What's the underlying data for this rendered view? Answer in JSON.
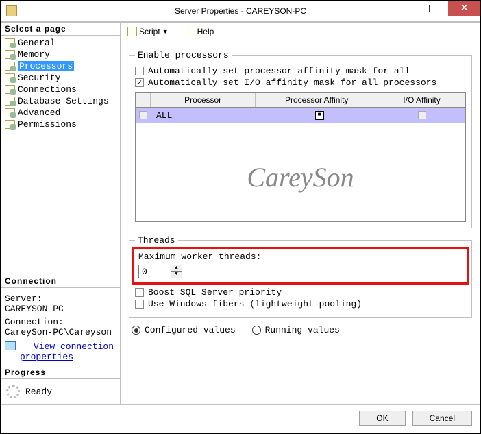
{
  "titlebar": {
    "text": "Server Properties - CAREYSON-PC"
  },
  "sidebar": {
    "select_header": "Select a page",
    "pages": [
      {
        "label": "General"
      },
      {
        "label": "Memory"
      },
      {
        "label": "Processors"
      },
      {
        "label": "Security"
      },
      {
        "label": "Connections"
      },
      {
        "label": "Database Settings"
      },
      {
        "label": "Advanced"
      },
      {
        "label": "Permissions"
      }
    ],
    "connection_header": "Connection",
    "server_label": "Server:",
    "server_value": "CAREYSON-PC",
    "conn_label": "Connection:",
    "conn_value": "CareySon-PC\\Careyson",
    "view_link1": "View connection",
    "view_link2": "properties",
    "progress_header": "Progress",
    "progress_state": "Ready"
  },
  "toolbar": {
    "script": "Script",
    "help": "Help"
  },
  "enable": {
    "legend": "Enable processors",
    "opt1": "Automatically set processor affinity mask for all",
    "opt2": "Automatically set I/O affinity mask for all processors",
    "th_proc": "Processor",
    "th_pa": "Processor Affinity",
    "th_io": "I/O Affinity",
    "row_all": "ALL"
  },
  "watermark": "CareySon",
  "threads": {
    "legend": "Threads",
    "max_label": "Maximum worker threads:",
    "max_value": "0",
    "boost": "Boost SQL Server priority",
    "fibers": "Use Windows fibers (lightweight pooling)"
  },
  "values": {
    "configured": "Configured  values",
    "running": "Running values"
  },
  "buttons": {
    "ok": "OK",
    "cancel": "Cancel"
  }
}
